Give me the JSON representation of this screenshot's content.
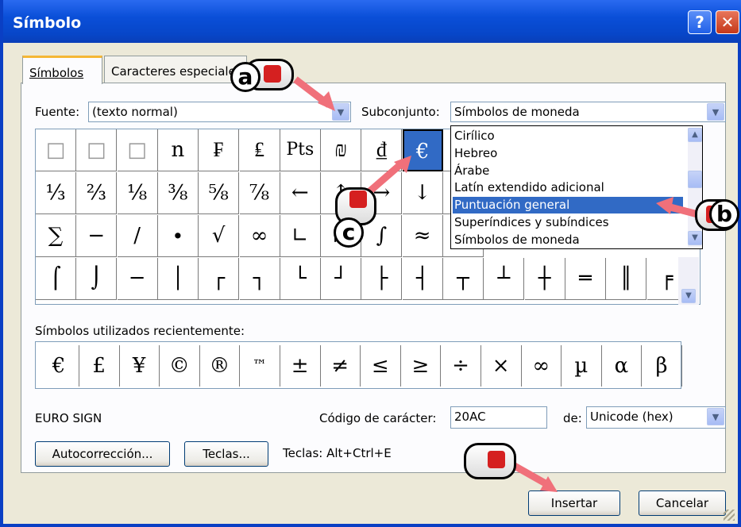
{
  "window": {
    "title": "Símbolo",
    "help_label": "?",
    "close_label": "✕"
  },
  "tabs": [
    {
      "label": "Símbolos",
      "selected": true
    },
    {
      "label": "Caracteres especiales",
      "selected": false
    }
  ],
  "font": {
    "label": "Fuente:",
    "value": "(texto normal)"
  },
  "subset": {
    "label": "Subconjunto:",
    "value": "Símbolos de moneda"
  },
  "subset_dropdown": {
    "items": [
      "Cirílico",
      "Hebreo",
      "Árabe",
      "Latín extendido adicional",
      "Puntuación general",
      "Superíndices y subíndices",
      "Símbolos de moneda"
    ],
    "highlighted": "Puntuación general"
  },
  "symbol_grid": {
    "rows": [
      [
        "□",
        "□",
        "□",
        "n",
        "₣",
        "₤",
        "Pts",
        "₪",
        "₫",
        "€",
        "₭"
      ],
      [
        "⅓",
        "⅔",
        "⅛",
        "⅜",
        "⅝",
        "⅞",
        "←",
        "↑",
        "→",
        "↓",
        "↔"
      ],
      [
        "∑",
        "−",
        "∕",
        "∙",
        "√",
        "∞",
        "∟",
        "∩",
        "∫",
        "≈",
        "≠"
      ],
      [
        "⌠",
        "⌡",
        "─",
        "│",
        "┌",
        "┐",
        "└",
        "┘",
        "├",
        "┤",
        "┬",
        "┴",
        "┼",
        "═",
        "║",
        "╒"
      ]
    ],
    "row1_tail": [
      "",
      "",
      "",
      "",
      "",
      ""
    ],
    "selected": "€"
  },
  "recent": {
    "label": "Símbolos utilizados recientemente:",
    "symbols": [
      "€",
      "£",
      "¥",
      "©",
      "®",
      "™",
      "±",
      "≠",
      "≤",
      "≥",
      "÷",
      "×",
      "∞",
      "µ",
      "α",
      "β"
    ]
  },
  "char_name": "EURO SIGN",
  "char_code": {
    "label": "Código de carácter:",
    "value": "20AC"
  },
  "from": {
    "label": "de:",
    "value": "Unicode (hex)"
  },
  "buttons": {
    "autocorrect": "Autocorrección...",
    "keys": "Teclas...",
    "shortcut": "Teclas: Alt+Ctrl+E",
    "insert": "Insertar",
    "cancel": "Cancelar"
  },
  "callouts": {
    "a": "a",
    "b": "b",
    "c": "c"
  },
  "colors": {
    "titlebar": "#0a4fd8",
    "selection": "#316ac5",
    "arrow": "#f0707a"
  }
}
